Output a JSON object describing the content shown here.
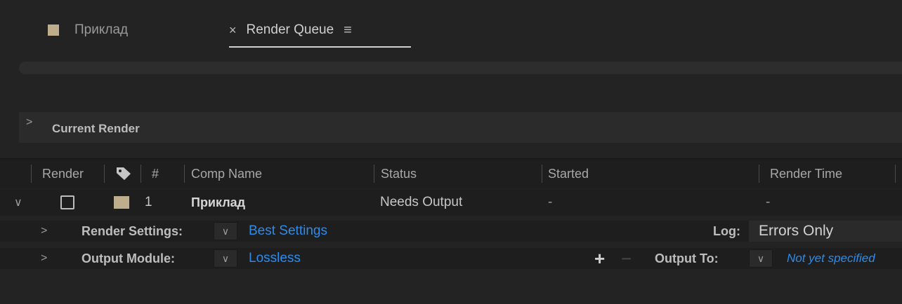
{
  "tabs": [
    {
      "label": "Приклад",
      "active": false
    },
    {
      "label": "Render Queue",
      "active": true
    }
  ],
  "icons": {
    "tab_swatch": "composition-color-swatch",
    "close": "close-icon",
    "menu": "hamburger-menu-icon"
  },
  "current_render": {
    "label": "Current Render"
  },
  "columns": {
    "render": "Render",
    "label_icon": "label-tag-icon",
    "number": "#",
    "comp_name": "Comp Name",
    "status": "Status",
    "started": "Started",
    "render_time": "Render Time"
  },
  "item": {
    "number": "1",
    "comp_name": "Приклад",
    "status": "Needs Output",
    "started": "-",
    "render_time": "-",
    "render_settings_label": "Render Settings:",
    "render_settings_value": "Best Settings",
    "log_label": "Log:",
    "log_value": "Errors Only",
    "output_module_label": "Output Module:",
    "output_module_value": "Lossless",
    "output_to_label": "Output To:",
    "output_to_value": "Not yet specified"
  },
  "colors": {
    "accent_link": "#2d8ceb",
    "swatch": "#bfae8c",
    "background": "#232323"
  }
}
